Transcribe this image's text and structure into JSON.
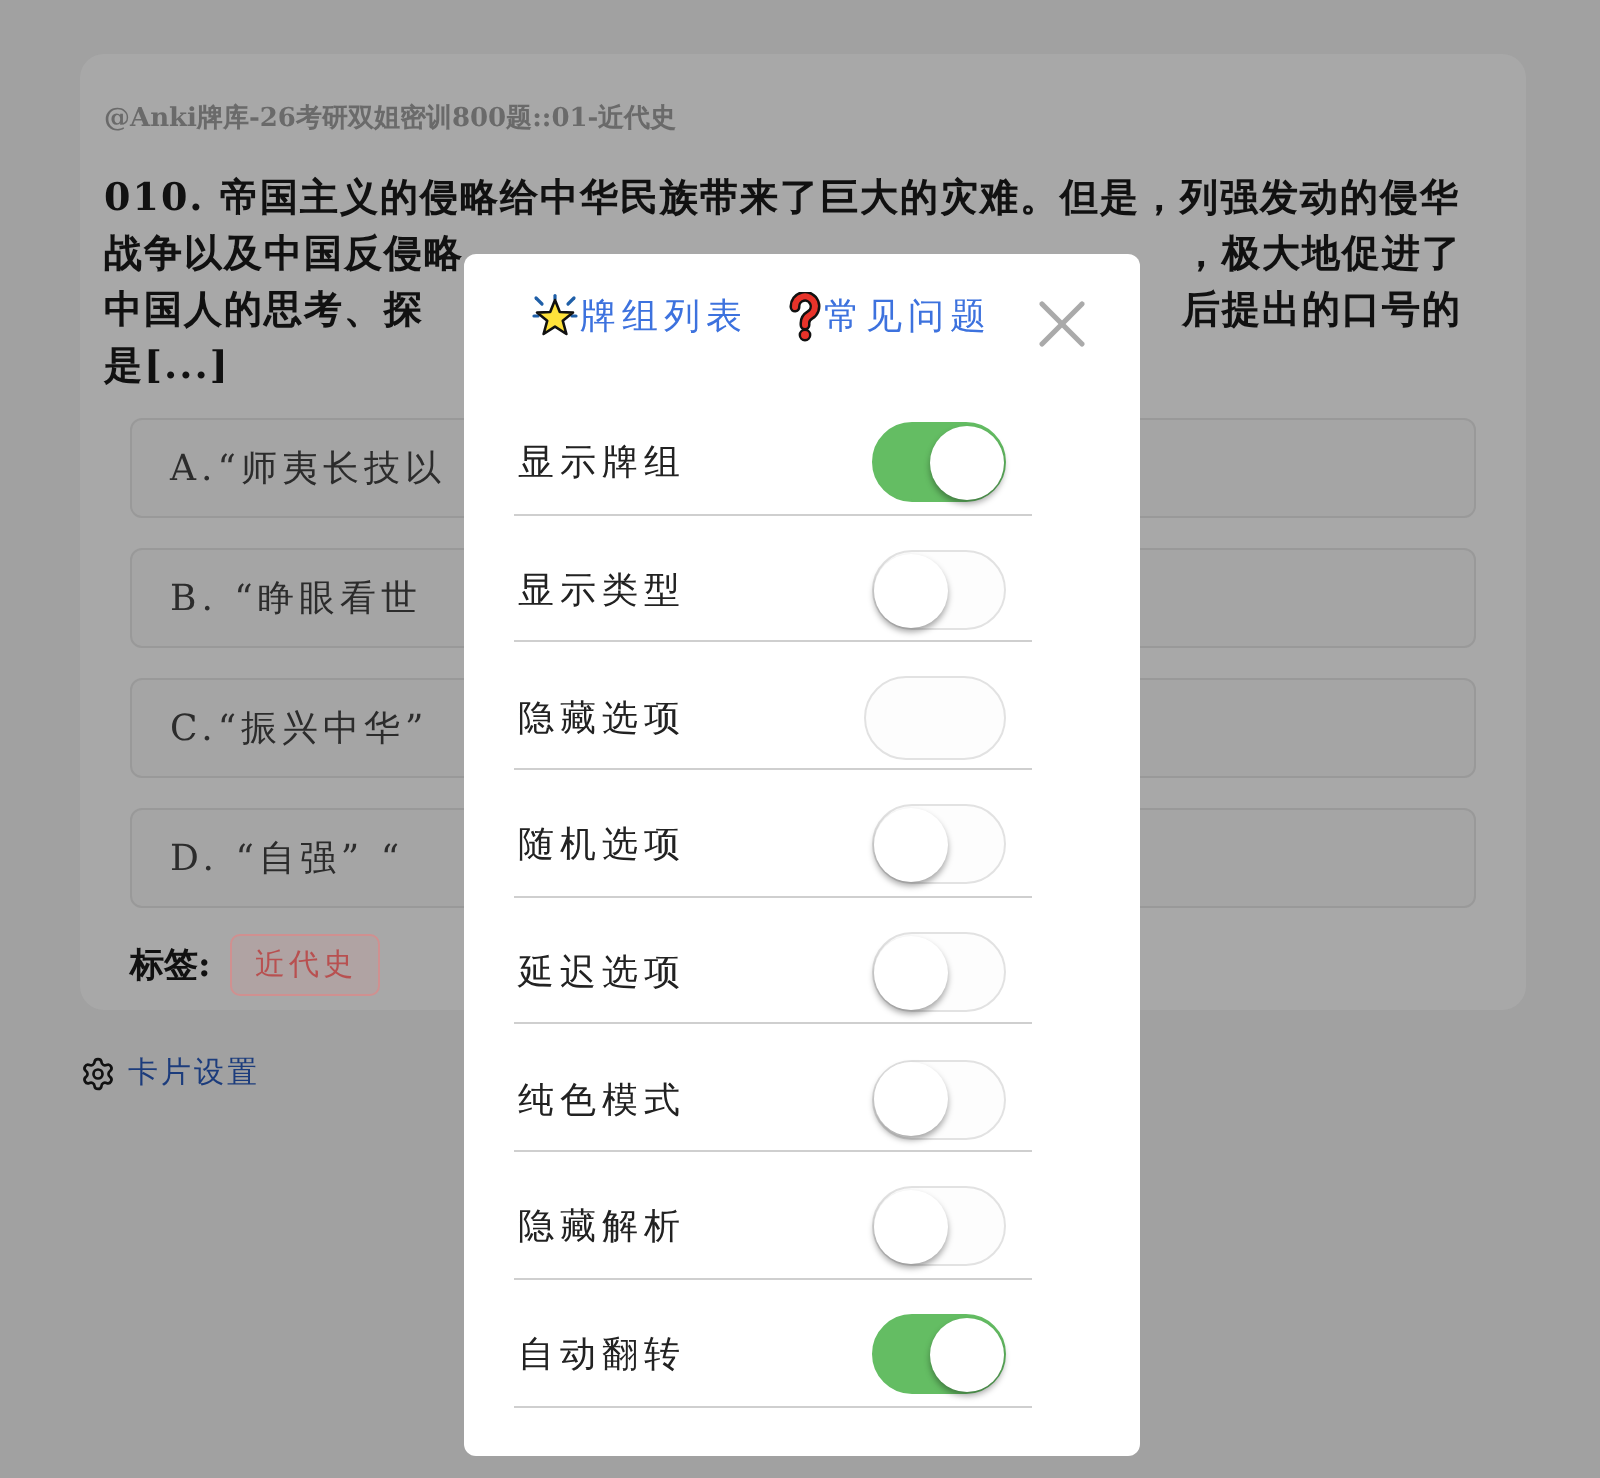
{
  "deck_path": "@Anki牌库-26考研双姐密训800题::01-近代史",
  "question_lines": [
    {
      "left": "010. 帝国主义的侵略给中华民族带来了巨大的灾难。但是，列强发动的侵华"
    },
    {
      "left": "战争以及中国反侵略",
      "right": "，极大地促进了"
    },
    {
      "left": "中国人的思考、探",
      "right": "后提出的口号的"
    },
    {
      "left": "是[...]"
    }
  ],
  "options": [
    {
      "text": "A.“师夷长技以"
    },
    {
      "text": "B. “睁眼看世"
    },
    {
      "text": "C.“振兴中华”"
    },
    {
      "text": "D. “自强” “"
    }
  ],
  "tags": {
    "label": "标签:",
    "items": [
      "近代史"
    ]
  },
  "card_settings_link": "卡片设置",
  "dialog": {
    "tabs": [
      {
        "label": "牌组列表",
        "kind": "star"
      },
      {
        "label": "常见问题",
        "kind": "question"
      }
    ],
    "settings": [
      {
        "label": "显示牌组",
        "on": true,
        "kind": "switch"
      },
      {
        "label": "显示类型",
        "on": false,
        "kind": "switch"
      },
      {
        "label": "隐藏选项",
        "on": false,
        "kind": "blank-switch"
      },
      {
        "label": "随机选项",
        "on": false,
        "kind": "switch"
      },
      {
        "label": "延迟选项",
        "on": false,
        "kind": "switch"
      },
      {
        "label": "纯色模式",
        "on": false,
        "kind": "switch"
      },
      {
        "label": "隐藏解析",
        "on": false,
        "kind": "switch"
      },
      {
        "label": "自动翻转",
        "on": true,
        "kind": "switch"
      }
    ]
  }
}
